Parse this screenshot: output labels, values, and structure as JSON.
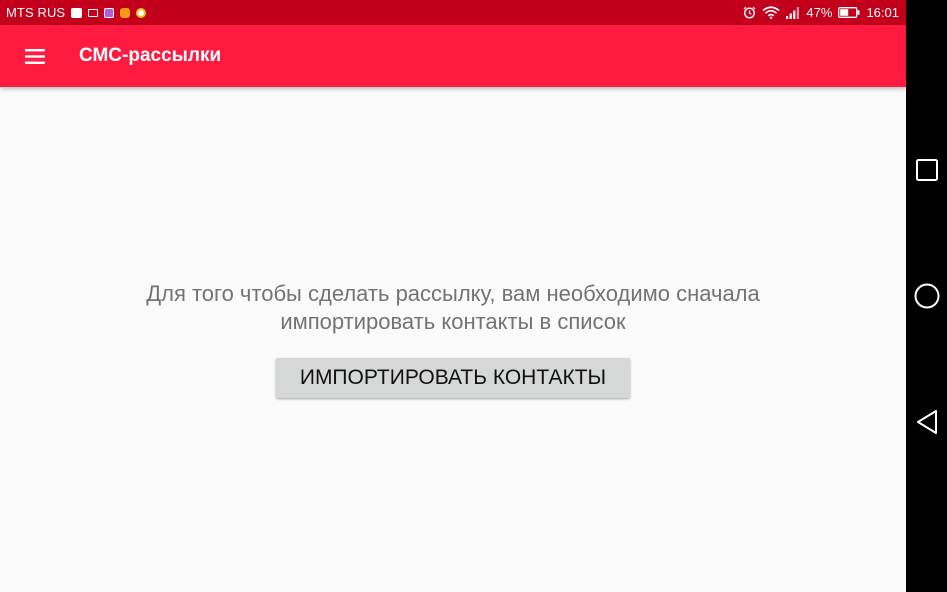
{
  "status_bar": {
    "carrier": "MTS RUS",
    "battery": "47%",
    "time": "16:01",
    "icons_left": [
      "news-icon",
      "mail-icon",
      "gallery-icon",
      "odnoklassniki-icon",
      "chrome-icon"
    ],
    "icons_right": [
      "alarm-icon",
      "wifi-icon",
      "signal-icon",
      "battery-icon"
    ]
  },
  "app_bar": {
    "title": "СМС-рассылки",
    "menu_icon": "hamburger-menu-icon"
  },
  "content": {
    "message_line1": "Для того чтобы сделать рассылку, вам необходимо сначала",
    "message_line2": "импортировать контакты в список",
    "import_button_label": "ИМПОРТИРОВАТЬ КОНТАКТЫ"
  },
  "nav_bar": {
    "buttons": [
      "recents-square-icon",
      "home-circle-icon",
      "back-triangle-icon"
    ]
  },
  "colors": {
    "status_bar": "#c2001b",
    "app_bar": "#ff1a40",
    "background": "#fafafa",
    "button": "#d6d7d7",
    "message_text": "#737373"
  }
}
